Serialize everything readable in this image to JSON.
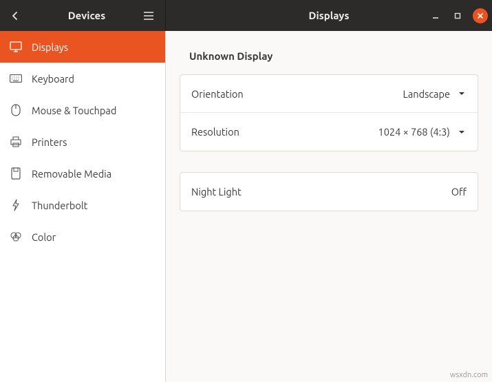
{
  "header": {
    "left_title": "Devices",
    "right_title": "Displays"
  },
  "sidebar": {
    "items": [
      {
        "label": "Displays"
      },
      {
        "label": "Keyboard"
      },
      {
        "label": "Mouse & Touchpad"
      },
      {
        "label": "Printers"
      },
      {
        "label": "Removable Media"
      },
      {
        "label": "Thunderbolt"
      },
      {
        "label": "Color"
      }
    ]
  },
  "main": {
    "section_title": "Unknown Display",
    "rows": {
      "orientation": {
        "label": "Orientation",
        "value": "Landscape"
      },
      "resolution": {
        "label": "Resolution",
        "value": "1024 × 768 (4:3)"
      },
      "night_light": {
        "label": "Night Light",
        "value": "Off"
      }
    }
  },
  "watermark": "wsxdn.com"
}
